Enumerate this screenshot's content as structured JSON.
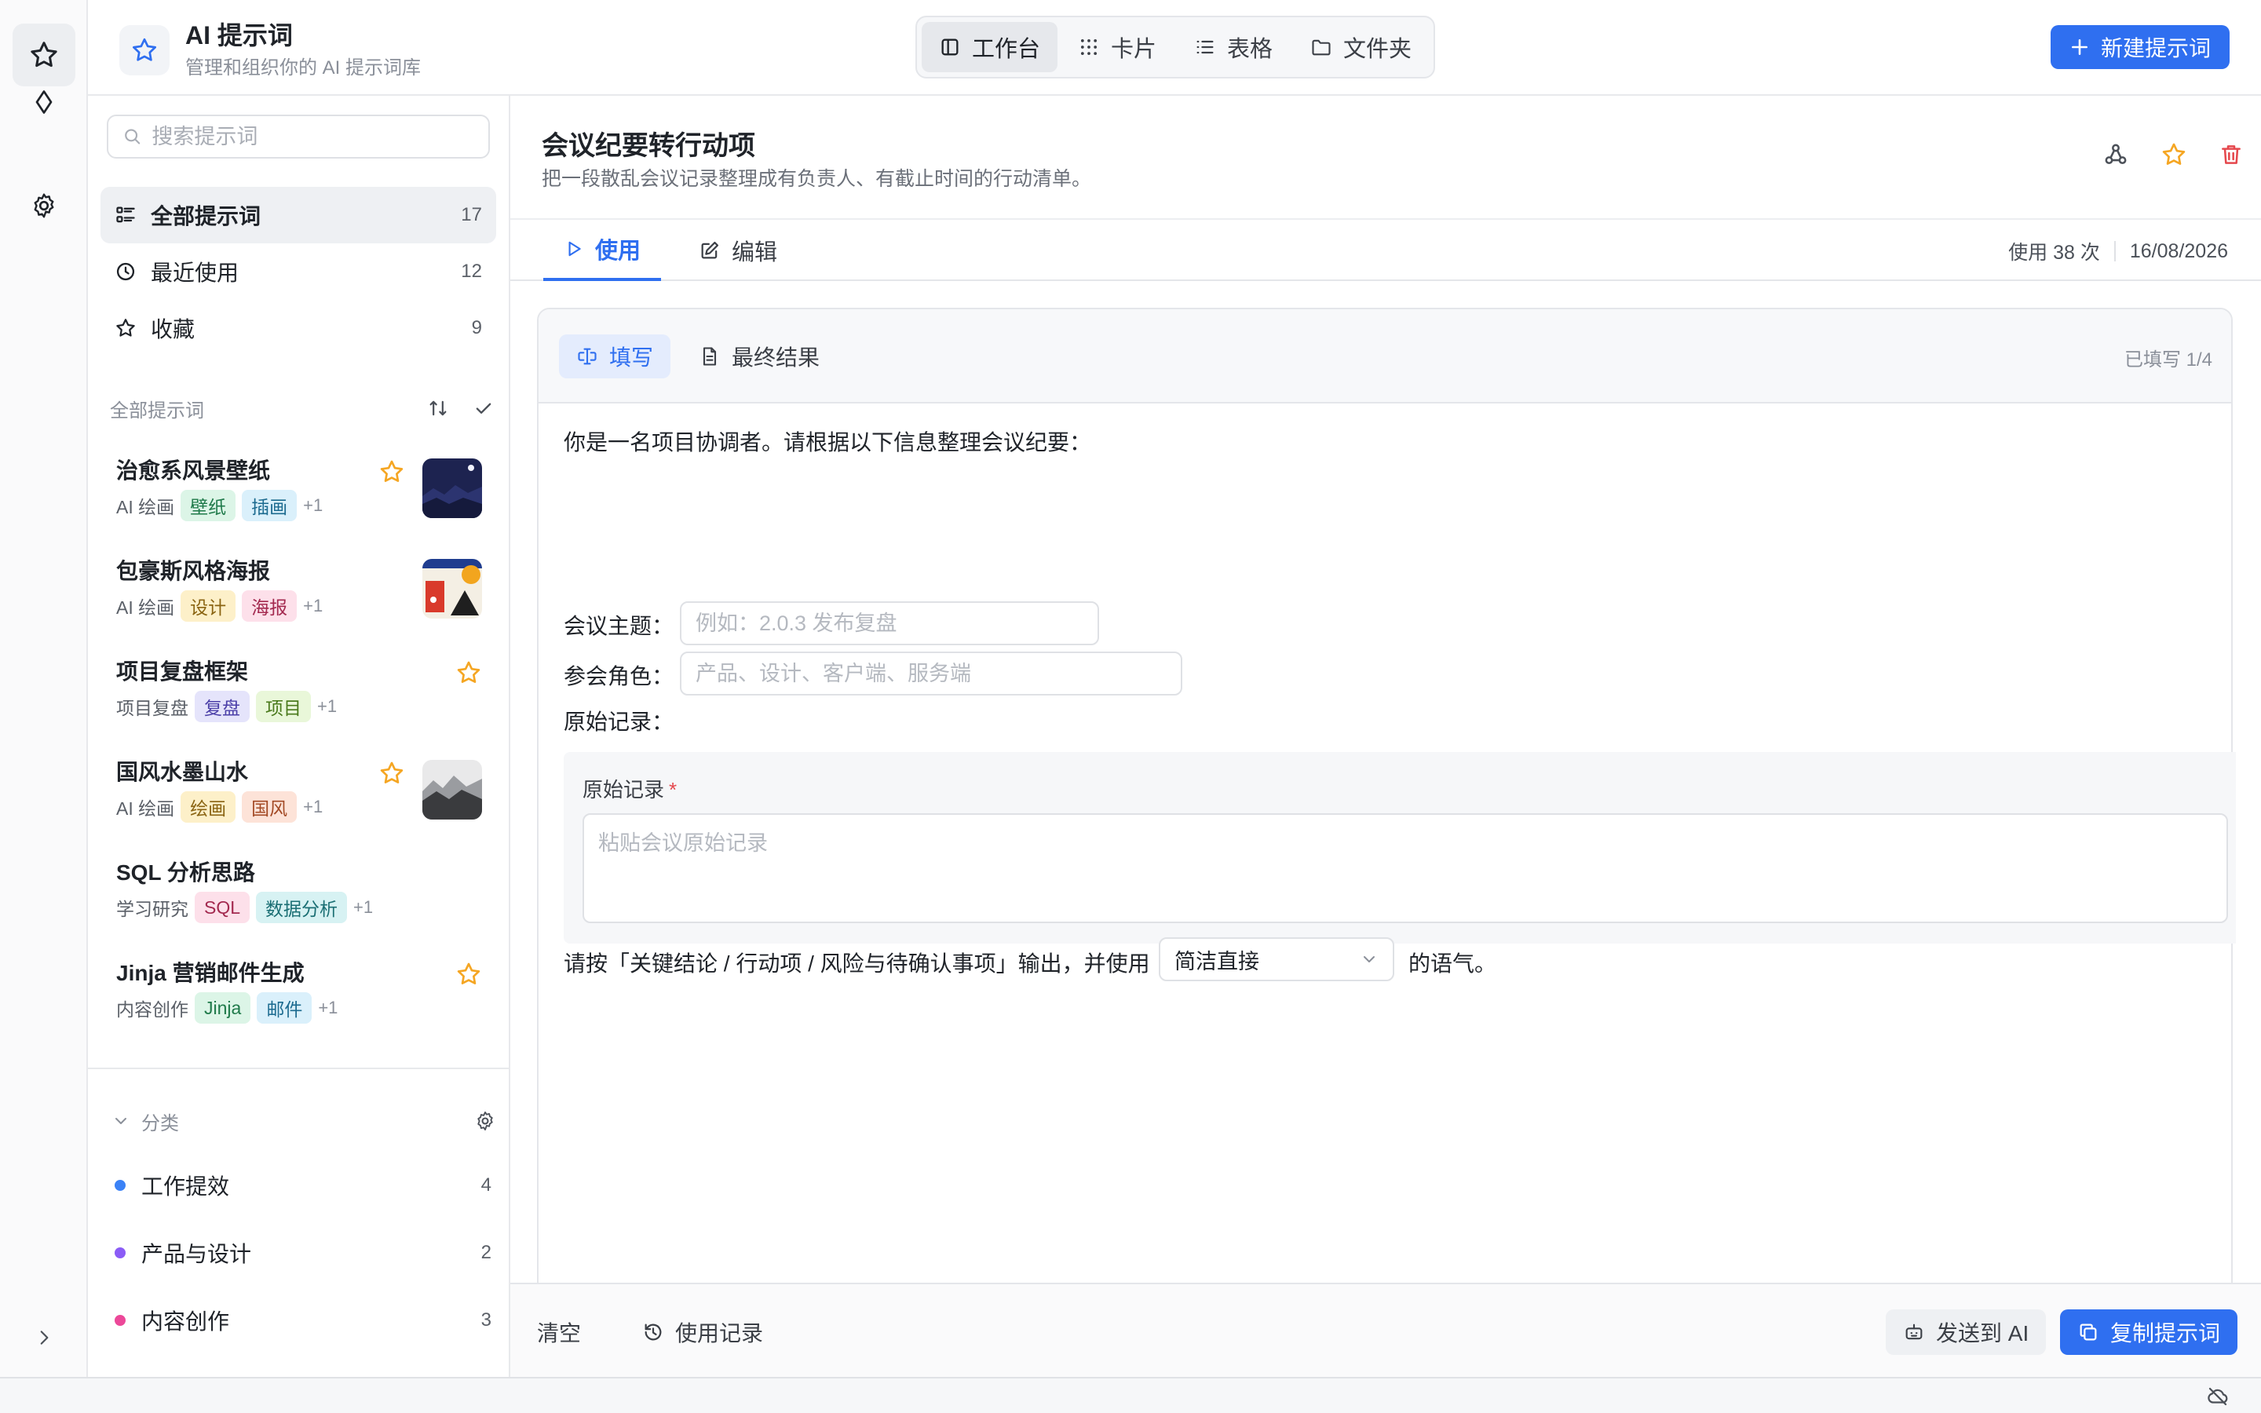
{
  "app": {
    "title": "AI 提示词",
    "subtitle": "管理和组织你的 AI 提示词库",
    "new_button": "新建提示词"
  },
  "view_switch": [
    {
      "label": "工作台",
      "icon": "panel-icon",
      "active": true
    },
    {
      "label": "卡片",
      "icon": "grid-icon",
      "active": false
    },
    {
      "label": "表格",
      "icon": "list-icon",
      "active": false
    },
    {
      "label": "文件夹",
      "icon": "folder-icon",
      "active": false
    }
  ],
  "sidebar": {
    "search_placeholder": "搜索提示词",
    "nav": [
      {
        "label": "全部提示词",
        "count": "17",
        "icon": "list-icon"
      },
      {
        "label": "最近使用",
        "count": "12",
        "icon": "clock-icon"
      },
      {
        "label": "收藏",
        "count": "9",
        "icon": "star-icon"
      }
    ],
    "list_header": "全部提示词",
    "prompts": [
      {
        "title": "治愈系风景壁纸",
        "category": "AI 绘画",
        "tags": [
          "壁纸",
          "插画"
        ],
        "more": "+1",
        "starred": true
      },
      {
        "title": "包豪斯风格海报",
        "category": "AI 绘画",
        "tags": [
          "设计",
          "海报"
        ],
        "more": "+1",
        "starred": false
      },
      {
        "title": "项目复盘框架",
        "category": "项目复盘",
        "tags": [
          "复盘",
          "项目"
        ],
        "more": "+1",
        "starred": true
      },
      {
        "title": "国风水墨山水",
        "category": "AI 绘画",
        "tags": [
          "绘画",
          "国风"
        ],
        "more": "+1",
        "starred": true
      },
      {
        "title": "SQL 分析思路",
        "category": "学习研究",
        "tags": [
          "SQL",
          "数据分析"
        ],
        "more": "+1",
        "starred": false
      },
      {
        "title": "Jinja 营销邮件生成",
        "category": "内容创作",
        "tags": [
          "Jinja",
          "邮件"
        ],
        "more": "+1",
        "starred": true
      }
    ],
    "categories_header": "分类",
    "categories": [
      {
        "label": "工作提效",
        "count": "4",
        "color": "#3b82f6"
      },
      {
        "label": "产品与设计",
        "count": "2",
        "color": "#8b5cf6"
      },
      {
        "label": "内容创作",
        "count": "3",
        "color": "#ec4899"
      }
    ]
  },
  "prompt": {
    "title": "会议纪要转行动项",
    "description": "把一段散乱会议记录整理成有负责人、有截止时间的行动清单。",
    "tabs": [
      "使用",
      "编辑"
    ],
    "usage": "使用 38 次",
    "date": "16/08/2026"
  },
  "fill": {
    "tabs": [
      "填写",
      "最终结果"
    ],
    "progress": "已填写 1/4",
    "intro": "你是一名项目协调者。请根据以下信息整理会议纪要：",
    "topic_label": "会议主题：",
    "topic_placeholder": "例如：2.0.3 发布复盘",
    "roles_label": "参会角色：",
    "roles_placeholder": "产品、设计、客户端、服务端",
    "raw_label_inline": "原始记录：",
    "raw_label": "原始记录",
    "raw_required": "*",
    "raw_placeholder": "粘贴会议原始记录",
    "output_prefix": "请按「关键结论 / 行动项 / 风险与待确认事项」输出，并使用",
    "tone_value": "简洁直接",
    "output_suffix": "的语气。"
  },
  "footer": {
    "clear": "清空",
    "history": "使用记录",
    "send": "发送到 AI",
    "copy": "复制提示词"
  },
  "colors": {
    "accent": "#2f6ff0",
    "star": "#f5a623",
    "danger": "#e5484d"
  }
}
